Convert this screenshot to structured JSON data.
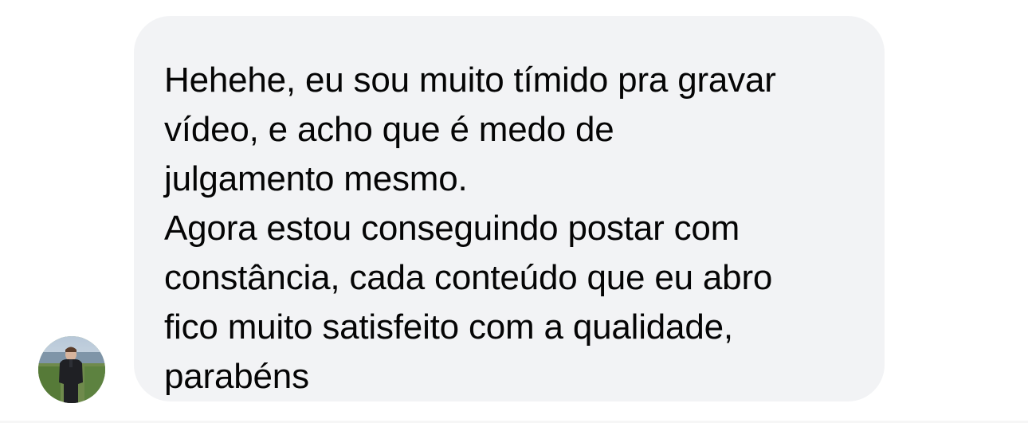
{
  "message": {
    "paragraphs": [
      {
        "lines": [
          "Hehehe, eu sou muito tímido pra gravar",
          "vídeo, e acho que é medo de",
          "julgamento mesmo."
        ]
      },
      {
        "lines": [
          "Agora estou conseguindo postar com",
          "constância, cada conteúdo que eu abro",
          "fico muito satisfeito com a qualidade,",
          "parabéns"
        ]
      }
    ]
  },
  "sender": {
    "avatar": "profile-photo"
  },
  "colors": {
    "bubble_background": "#f2f3f5",
    "text": "#050505",
    "page_background": "#ffffff"
  }
}
